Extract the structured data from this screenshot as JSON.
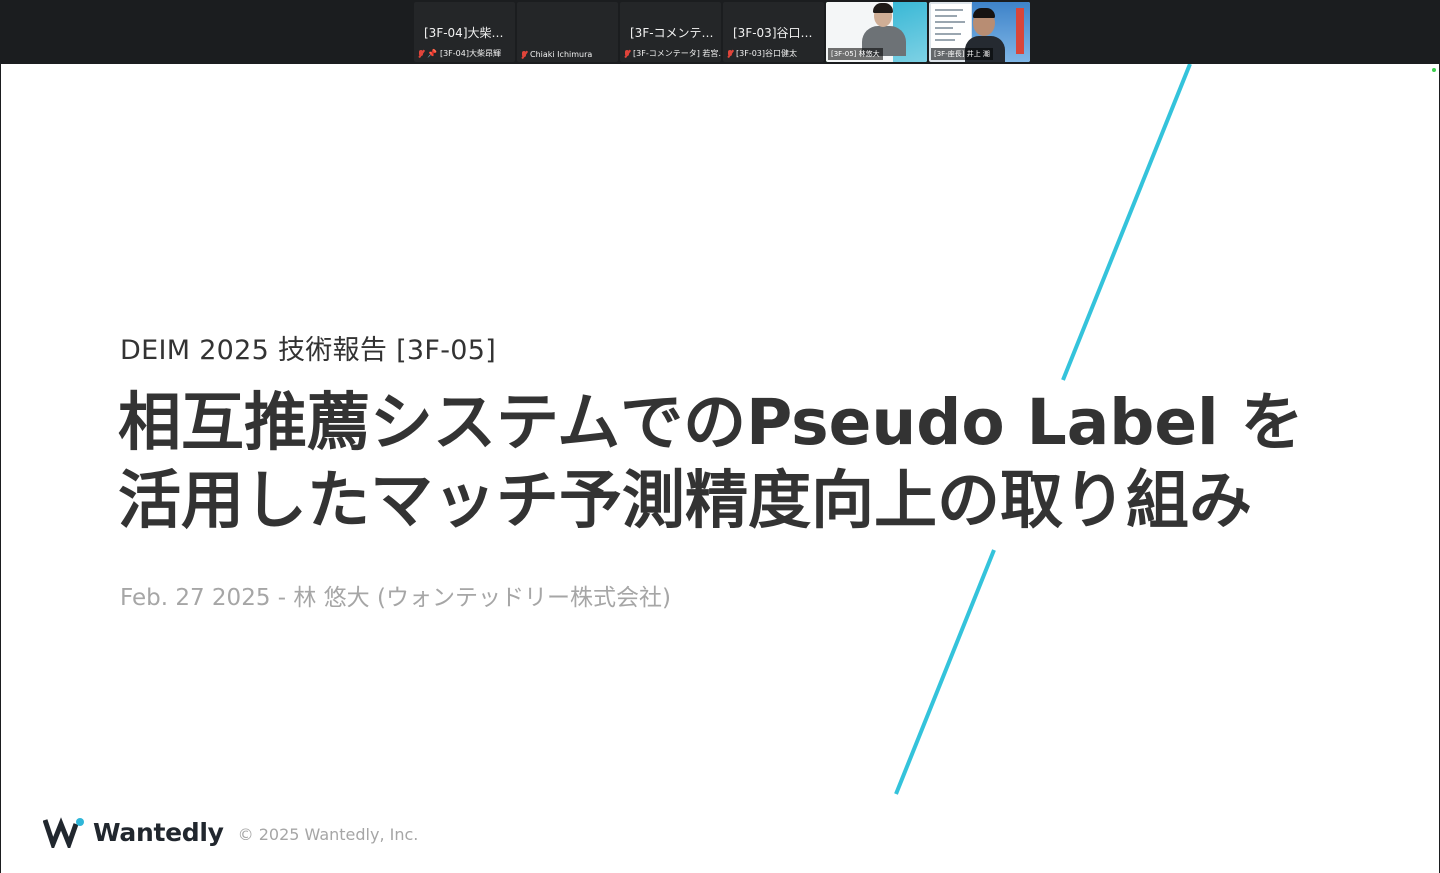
{
  "participants": [
    {
      "id": "p1",
      "display_name": "[3F-04]大柴…",
      "label": "[3F-04]大柴昂輝",
      "mic_muted": true,
      "pinned": true
    },
    {
      "id": "p2",
      "display_name": "",
      "label": "Chiaki Ichimura",
      "mic_muted": true,
      "pinned": false,
      "video_on": true
    },
    {
      "id": "p3",
      "display_name": "[3F-コメンテ…",
      "label": "[3F-コメンテータ] 若宮…",
      "mic_muted": true,
      "pinned": false
    },
    {
      "id": "p4",
      "display_name": "[3F-03]谷口…",
      "label": "[3F-03]谷口健太",
      "mic_muted": true,
      "pinned": false
    },
    {
      "id": "p5",
      "display_name": "",
      "label": "[3F-05] 林悠大",
      "mic_muted": false,
      "pinned": false,
      "video_on": true,
      "active_speaker": true
    },
    {
      "id": "p6",
      "display_name": "",
      "label": "[3F-座長] 井上 潮",
      "mic_muted": false,
      "pinned": false,
      "video_on": true
    }
  ],
  "slide": {
    "subtitle": "DEIM 2025 技術報告 [3F-05]",
    "title_line1": "相互推薦システムでのPseudo Label を",
    "title_line2": "活用したマッチ予測精度向上の取り組み",
    "byline": "Feb. 27 2025 - 林 悠大 (ウォンテッドリー株式会社)",
    "logo_text": "Wantedly",
    "copyright": "© 2025 Wantedly, Inc."
  },
  "colors": {
    "accent_line": "#34c3db",
    "logo_accent": "#2fb6d8",
    "title_text": "#333333",
    "muted_text": "#a6a6a6",
    "active_border": "#3ccf4e",
    "mic_muted": "#e0443a"
  },
  "icons": [
    "mic-muted-icon",
    "pin-icon",
    "wantedly-logo-icon"
  ]
}
